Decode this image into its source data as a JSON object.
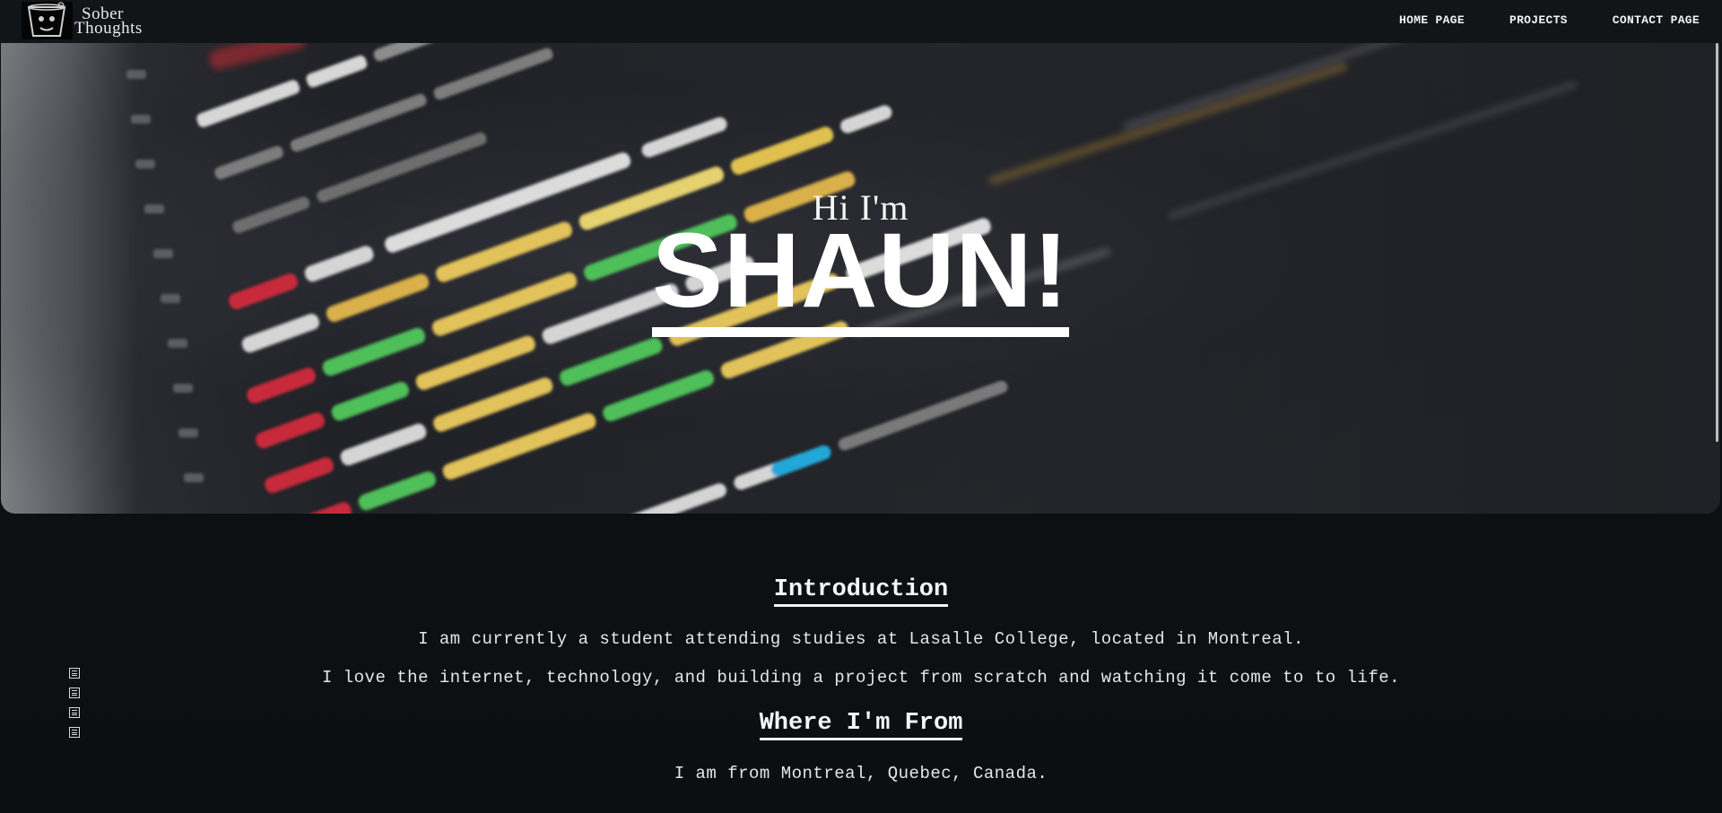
{
  "brand": {
    "line1": "Sober",
    "line2": "Thoughts",
    "logo_icon": "glass-face-logo-icon"
  },
  "nav": {
    "items": [
      {
        "label": "HOME PAGE"
      },
      {
        "label": "PROJECTS"
      },
      {
        "label": "CONTACT PAGE"
      }
    ]
  },
  "hero": {
    "subtitle": "Hi I'm",
    "title": "SHAUN!",
    "background": "blurred-code-screen-image"
  },
  "intro": {
    "heading": "Introduction",
    "line1": "I am currently a student attending studies at Lasalle College, located in Montreal.",
    "line2": "I love the internet, technology, and building a project from scratch and watching it come to to life."
  },
  "origin": {
    "heading": "Where I'm From",
    "line1": "I am from Montreal, Quebec, Canada."
  },
  "social_icons": [
    {
      "icon": "social-icon-1"
    },
    {
      "icon": "social-icon-2"
    },
    {
      "icon": "social-icon-3"
    },
    {
      "icon": "social-icon-4"
    }
  ],
  "colors": {
    "background": "#0d1114",
    "navbar": "#111518",
    "text": "#f5f5f5"
  }
}
